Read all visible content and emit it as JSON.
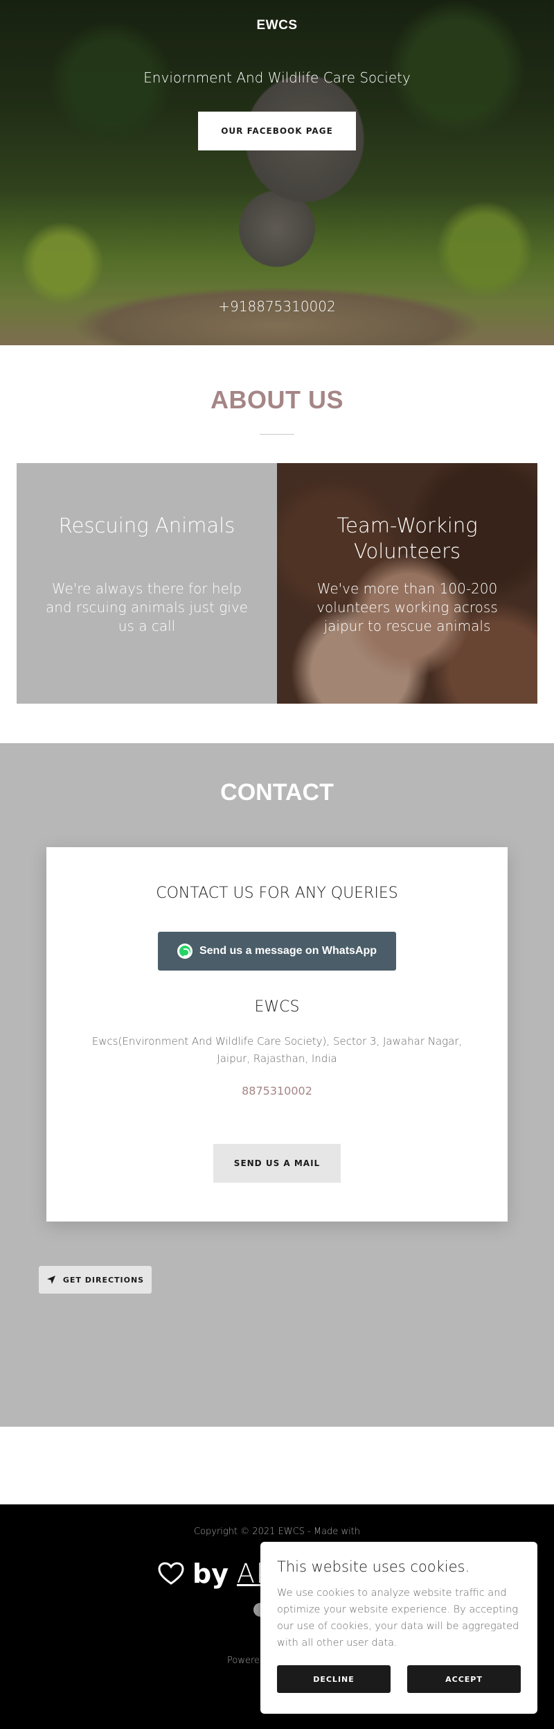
{
  "hero": {
    "logo": "EWCS",
    "tagline": "Enviornment And Wildlife Care Society",
    "facebook_button": "OUR FACEBOOK PAGE",
    "phone": "+918875310002"
  },
  "about": {
    "title": "ABOUT US",
    "cards": [
      {
        "title": "Rescuing Animals",
        "text": "We're always there for help and rscuing animals just give us a call"
      },
      {
        "title": "Team-Working Volunteers",
        "text": "We've more than 100-200 volunteers working across jaipur to rescue animals"
      }
    ]
  },
  "contact": {
    "title": "CONTACT",
    "heading": "CONTACT US FOR ANY QUERIES",
    "whatsapp_button": "Send us a message on WhatsApp",
    "business_name": "EWCS",
    "address": "Ewcs(Environment And Wildlife Care Society), Sector 3, Jawahar Nagar, Jaipur, Rajasthan, India",
    "phone": "8875310002",
    "mail_button": "SEND US A MAIL",
    "directions_button": "GET DIRECTIONS"
  },
  "footer": {
    "copyright": "Copyright © 2021 EWCS - Made with",
    "by": "by",
    "author_partial": "Ak",
    "powered_partial": "Powere"
  },
  "cookie": {
    "title": "This website uses cookies.",
    "text": "We use cookies to analyze website traffic and optimize your website experience. By accepting our use of cookies, your data will be aggregated with all other user data.",
    "decline": "DECLINE",
    "accept": "ACCEPT"
  },
  "colors": {
    "accent": "#a58585",
    "contact_bg": "#b7b7b7",
    "whatsapp_button": "#4a5d68",
    "whatsapp_green": "#25d366"
  }
}
